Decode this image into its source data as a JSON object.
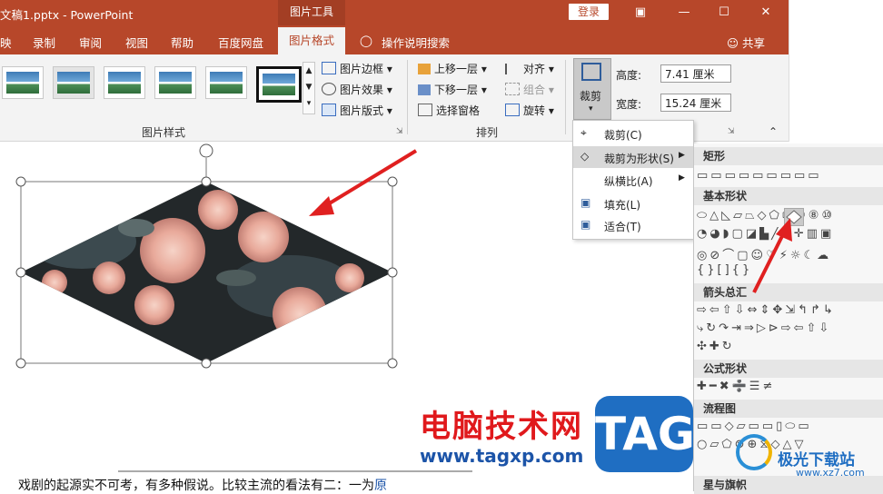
{
  "titlebar": {
    "doc_name": "文稿1.pptx  -  PowerPoint",
    "context_tools": "图片工具",
    "login": "登录"
  },
  "tabs": [
    "映",
    "录制",
    "审阅",
    "视图",
    "帮助",
    "百度网盘"
  ],
  "active_tab": "图片格式",
  "tell_me": "操作说明搜索",
  "share": "共享",
  "ribbon": {
    "picture_styles_group": "图片样式",
    "picture_border": "图片边框",
    "picture_effects": "图片效果",
    "picture_layout": "图片版式",
    "arrange_group": "排列",
    "bring_forward": "上移一层",
    "send_backward": "下移一层",
    "selection_pane": "选择窗格",
    "align": "对齐",
    "group": "组合",
    "rotate": "旋转",
    "crop": "裁剪",
    "height_label": "高度:",
    "height_value": "7.41 厘米",
    "width_label": "宽度:",
    "width_value": "15.24 厘米"
  },
  "crop_menu": {
    "crop": "裁剪(C)",
    "crop_to_shape": "裁剪为形状(S)",
    "aspect_ratio": "纵横比(A)",
    "fill": "填充(L)",
    "fit": "适合(T)"
  },
  "shapes_panel": {
    "rectangles": "矩形",
    "basic_shapes": "基本形状",
    "block_arrows": "箭头总汇",
    "equation_shapes": "公式形状",
    "flowchart": "流程图",
    "stars_banners": "星与旗帜"
  },
  "watermark": {
    "cn": "电脑技术网",
    "url": "www.tagxp.com",
    "tag": "TAG",
    "site2": "极光下载站",
    "site2_url": "www.xz7.com"
  },
  "body_text": "戏剧的起源实不可考，有多种假说。比较主流的看法有二：一为",
  "body_text_link": "原",
  "colors": {
    "accent": "#b7472a",
    "arrow": "#e02020"
  }
}
